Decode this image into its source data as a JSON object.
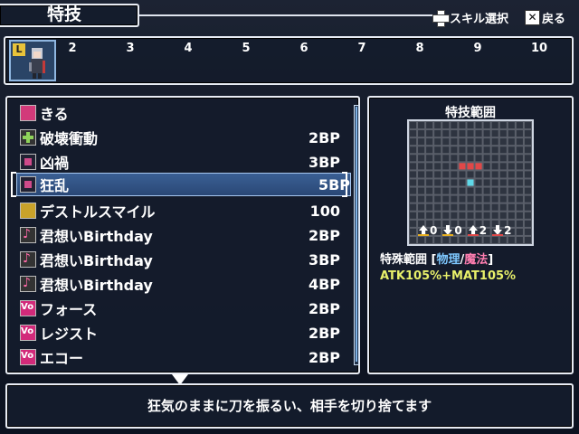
{
  "header": {
    "title": "特技",
    "hint_skill_select": "スキル選択",
    "hint_back": "戻る"
  },
  "party": {
    "leader_badge": "L",
    "slots": [
      "2",
      "3",
      "4",
      "5",
      "6",
      "7",
      "8",
      "9",
      "10"
    ]
  },
  "skills": [
    {
      "name": "きる",
      "cost": "",
      "icon": "slash-icon"
    },
    {
      "name": "破壊衝動",
      "cost": "2BP",
      "icon": "cross-icon"
    },
    {
      "name": "凶禍",
      "cost": "3BP",
      "icon": "square-icon"
    },
    {
      "name": "狂乱",
      "cost": "5BP",
      "icon": "square-icon",
      "selected": true
    },
    {
      "name": "デストルスマイル",
      "cost": "100",
      "icon": "gold-icon"
    },
    {
      "name": "君想いBirthday",
      "cost": "2BP",
      "icon": "note-icon"
    },
    {
      "name": "君想いBirthday",
      "cost": "3BP",
      "icon": "note-plus-icon"
    },
    {
      "name": "君想いBirthday",
      "cost": "4BP",
      "icon": "note-plus2-icon"
    },
    {
      "name": "フォース",
      "cost": "2BP",
      "icon": "vo-icon"
    },
    {
      "name": "レジスト",
      "cost": "2BP",
      "icon": "vo-icon"
    },
    {
      "name": "エコー",
      "cost": "2BP",
      "icon": "vo-icon"
    }
  ],
  "range": {
    "title": "特技範囲",
    "arrows": [
      "0",
      "0",
      "2",
      "2"
    ],
    "special_prefix": "特殊範囲 [",
    "special_phys": "物理",
    "special_sep": "/",
    "special_mag": "魔法",
    "special_suffix": "]",
    "atk_text": "ATK105%+MAT105%"
  },
  "description": "狂気のままに刀を振るい、相手を切り捨てます",
  "colors": {
    "selection": "#3a5f94",
    "phys": "#7ec8ff",
    "mag": "#ff7eb0",
    "atk": "#e8f06a",
    "target": "#e04848",
    "origin": "#5fd8e8"
  }
}
